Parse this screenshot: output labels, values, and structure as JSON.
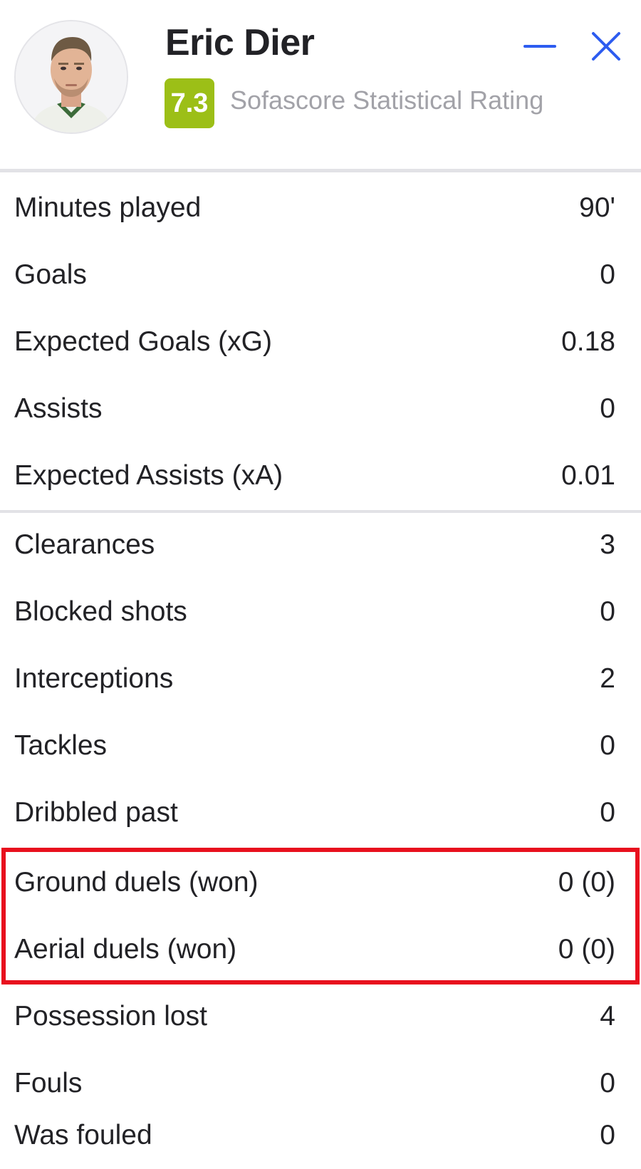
{
  "player": {
    "name": "Eric Dier",
    "rating": "7.3",
    "rating_label": "Sofascore Statistical Rating",
    "rating_color": "#9cbf17"
  },
  "header_buttons": {
    "minimize_icon": "minus-icon",
    "close_icon": "close-icon",
    "accent_color": "#2d5cf0"
  },
  "highlight": {
    "color": "#e8101e",
    "rows": [
      "Ground duels (won)",
      "Aerial duels (won)"
    ]
  },
  "stats_primary": [
    {
      "label": "Minutes played",
      "value": "90'"
    },
    {
      "label": "Goals",
      "value": "0"
    },
    {
      "label": "Expected Goals (xG)",
      "value": "0.18"
    },
    {
      "label": "Assists",
      "value": "0"
    },
    {
      "label": "Expected Assists (xA)",
      "value": "0.01"
    }
  ],
  "stats_secondary": [
    {
      "label": "Clearances",
      "value": "3"
    },
    {
      "label": "Blocked shots",
      "value": "0"
    },
    {
      "label": "Interceptions",
      "value": "2"
    },
    {
      "label": "Tackles",
      "value": "0"
    },
    {
      "label": "Dribbled past",
      "value": "0"
    },
    {
      "label": "Ground duels (won)",
      "value": "0 (0)"
    },
    {
      "label": "Aerial duels (won)",
      "value": "0 (0)"
    },
    {
      "label": "Possession lost",
      "value": "4"
    },
    {
      "label": "Fouls",
      "value": "0"
    },
    {
      "label": "Was fouled",
      "value": "0"
    }
  ]
}
